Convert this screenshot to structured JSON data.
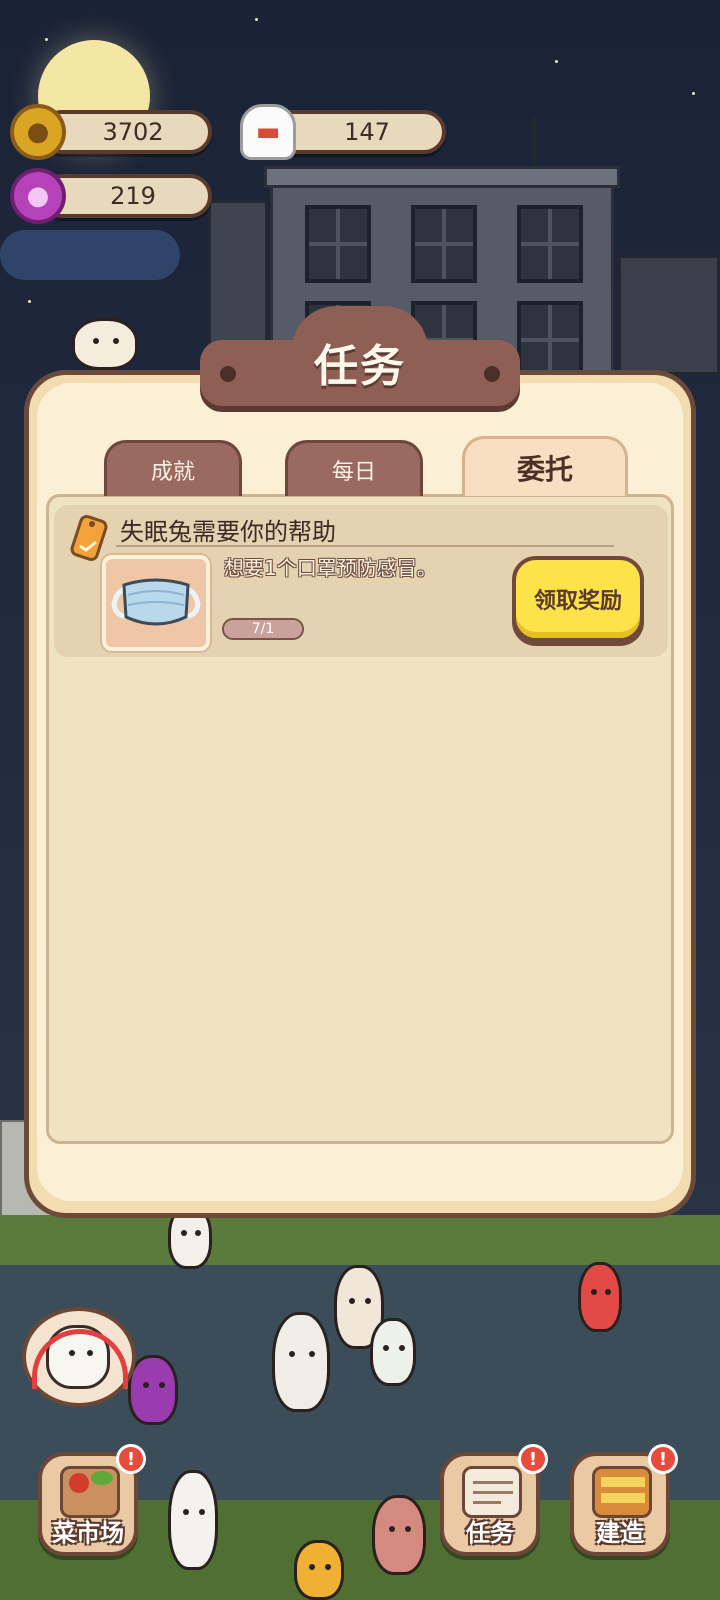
{
  "hud": {
    "coins": "3702",
    "chef_hats": "147",
    "paw_gems": "219"
  },
  "dialog": {
    "title": "任务",
    "tabs": [
      {
        "label": "成就",
        "active": false
      },
      {
        "label": "每日",
        "active": false
      },
      {
        "label": "委托",
        "active": true
      }
    ],
    "task": {
      "title": "失眠兔需要你的帮助",
      "description": "想要1个口罩预防感冒。",
      "progress_text": "7/1",
      "item_icon": "face-mask-icon",
      "claim_label": "领取奖励"
    }
  },
  "nav": {
    "market_label": "菜市场",
    "tasks_label": "任务",
    "build_label": "建造",
    "alert_symbol": "!"
  },
  "colors": {
    "dialog_bg": "#fbefd6",
    "plaque": "#8f5f55",
    "claim_button": "#fde24a",
    "alert": "#e64b3c"
  }
}
